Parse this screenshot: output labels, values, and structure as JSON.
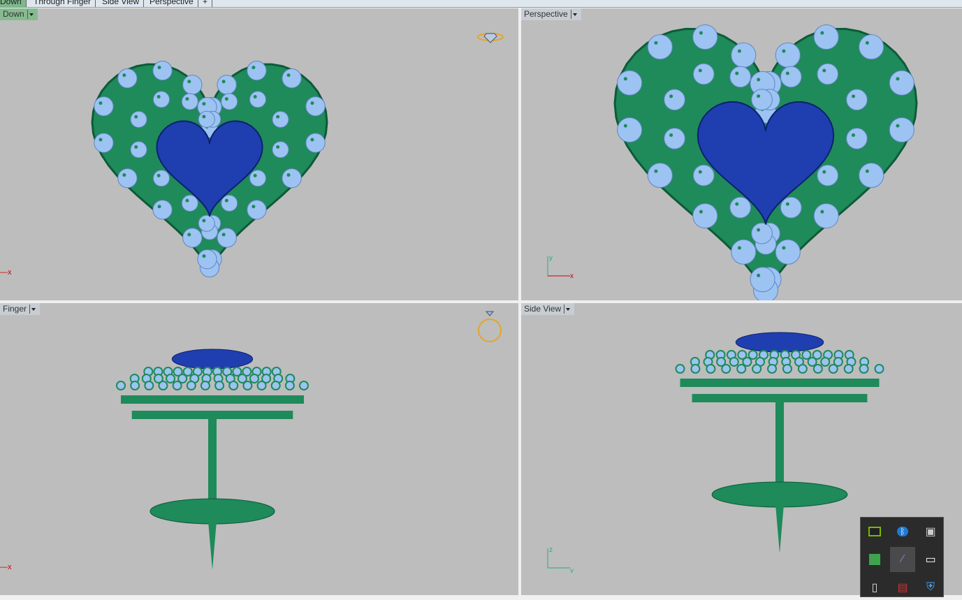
{
  "tabs": [
    {
      "label": "Down",
      "active": true
    },
    {
      "label": "Through Finger"
    },
    {
      "label": "Side View"
    },
    {
      "label": "Perspective"
    },
    {
      "label": "+"
    }
  ],
  "viewports": [
    {
      "label": "Down",
      "axes": [
        "x"
      ]
    },
    {
      "label": "Perspective",
      "axes": [
        "y",
        "x"
      ]
    },
    {
      "label": "Finger",
      "axes": [
        "x"
      ]
    },
    {
      "label": "Side View",
      "axes": [
        "z",
        "y"
      ]
    }
  ],
  "colors": {
    "metal": "#1f8a5a",
    "stone": "#9cc3f2",
    "gem": "#1f3fb0",
    "viewport": "#bdbdbd"
  },
  "tray": [
    "nvidia-icon",
    "bluetooth-icon",
    "usb-device-icon",
    "app-green-icon",
    "pen-feather-icon",
    "battery-power-icon",
    "usb-drive-icon",
    "app-pin-icon",
    "security-shield-icon"
  ]
}
